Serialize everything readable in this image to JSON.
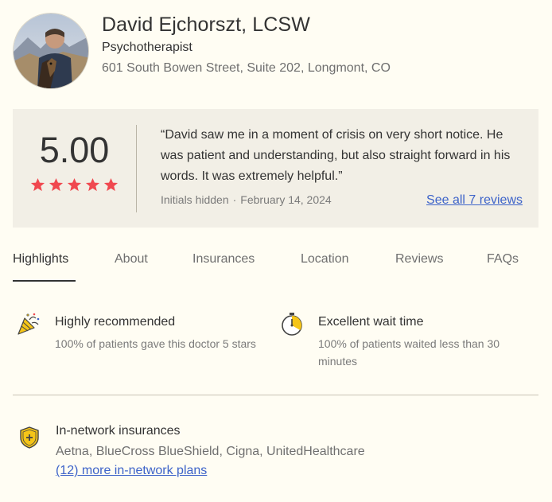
{
  "provider": {
    "name": "David Ejchorszt, LCSW",
    "specialty": "Psychotherapist",
    "address": "601 South Bowen Street, Suite 202, Longmont, CO"
  },
  "review": {
    "rating": "5.00",
    "stars": 5,
    "quote": "“David saw me in a moment of crisis on very short notice. He was patient and understanding, but also straight forward in his words. It was extremely helpful.”",
    "author": "Initials hidden",
    "separator": "·",
    "date": "February 14, 2024",
    "see_all": "See all 7 reviews"
  },
  "tabs": [
    "Highlights",
    "About",
    "Insurances",
    "Location",
    "Reviews",
    "FAQs"
  ],
  "active_tab": "Highlights",
  "highlights": [
    {
      "icon": "party-popper-icon",
      "title": "Highly recommended",
      "desc": "100% of patients gave this doctor 5 stars"
    },
    {
      "icon": "stopwatch-icon",
      "title": "Excellent wait time",
      "desc": "100% of patients waited less than 30 minutes"
    }
  ],
  "insurance": {
    "icon": "shield-plus-icon",
    "title": "In-network insurances",
    "list": "Aetna, BlueCross BlueShield, Cigna, UnitedHealthcare",
    "more": "(12) more in-network plans"
  },
  "colors": {
    "background": "#fffdf3",
    "card": "#f2efe6",
    "star": "#f0484f",
    "link": "#3d63c9",
    "accent_yellow": "#f5c518"
  }
}
